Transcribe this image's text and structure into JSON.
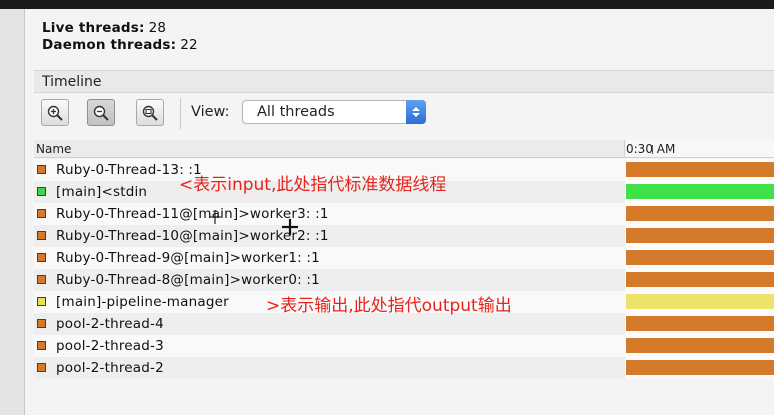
{
  "summary": {
    "live_threads_label": "Live threads:",
    "live_threads_value": "28",
    "daemon_threads_label": "Daemon threads:",
    "daemon_threads_value": "22"
  },
  "timeline": {
    "title": "Timeline",
    "view_label": "View:",
    "view_selected": "All threads",
    "zoom_buttons": [
      "zoom-in-icon",
      "zoom-out-icon",
      "zoom-fit-icon"
    ]
  },
  "table": {
    "name_header": "Name",
    "time_header": "0:30 AM",
    "rows": [
      {
        "name": "Ruby-0-Thread-13: :1",
        "color": "#d47a2a",
        "bar_color": "#d47a2a",
        "bar_fraction": 1.0
      },
      {
        "name": "[main]<stdin",
        "color": "#43d24a",
        "bar_color": "#3fe04a",
        "bar_fraction": 1.0
      },
      {
        "name": "Ruby-0-Thread-11@[main]>worker3: :1",
        "color": "#d47a2a",
        "bar_color": "#d47a2a",
        "bar_fraction": 1.0
      },
      {
        "name": "Ruby-0-Thread-10@[main]>worker2: :1",
        "color": "#d47a2a",
        "bar_color": "#d47a2a",
        "bar_fraction": 1.0
      },
      {
        "name": "Ruby-0-Thread-9@[main]>worker1: :1",
        "color": "#d47a2a",
        "bar_color": "#d47a2a",
        "bar_fraction": 1.0
      },
      {
        "name": "Ruby-0-Thread-8@[main]>worker0: :1",
        "color": "#d47a2a",
        "bar_color": "#d47a2a",
        "bar_fraction": 1.0
      },
      {
        "name": "[main]-pipeline-manager",
        "color": "#e8e05a",
        "bar_color": "#ede36a",
        "bar_fraction": 1.0
      },
      {
        "name": "pool-2-thread-4",
        "color": "#d47a2a",
        "bar_color": "#d47a2a",
        "bar_fraction": 1.0
      },
      {
        "name": "pool-2-thread-3",
        "color": "#d47a2a",
        "bar_color": "#d47a2a",
        "bar_fraction": 1.0
      },
      {
        "name": "pool-2-thread-2",
        "color": "#d47a2a",
        "bar_color": "#d47a2a",
        "bar_fraction": 1.0
      }
    ]
  },
  "annotations": {
    "input_note": "<表示input,此处指代标准数据线程",
    "output_note": ">表示输出,此处指代output输出",
    "color": "#e8231c"
  }
}
